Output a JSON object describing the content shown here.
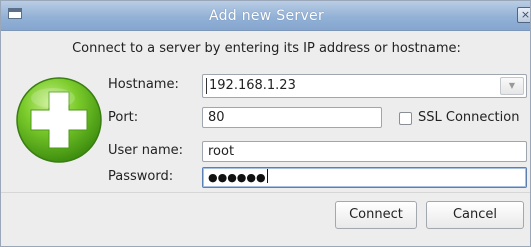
{
  "window": {
    "title": "Add new Server",
    "close_glyph": "×"
  },
  "dialog": {
    "description": "Connect to a server by entering its IP address or hostname:",
    "logo_icon": "green-plus-icon"
  },
  "form": {
    "hostname": {
      "label": "Hostname:",
      "value": "192.168.1.23"
    },
    "port": {
      "label": "Port:",
      "value": "80"
    },
    "ssl": {
      "label": "SSL Connection",
      "checked": false
    },
    "username": {
      "label": "User name:",
      "value": "root"
    },
    "password": {
      "label": "Password:",
      "masked_value": "●●●●●●"
    }
  },
  "buttons": {
    "connect": "Connect",
    "cancel": "Cancel"
  },
  "colors": {
    "titlebar": "#93b1d6",
    "logo_green": "#6fbf2a",
    "focus_border": "#5b7fb0"
  }
}
